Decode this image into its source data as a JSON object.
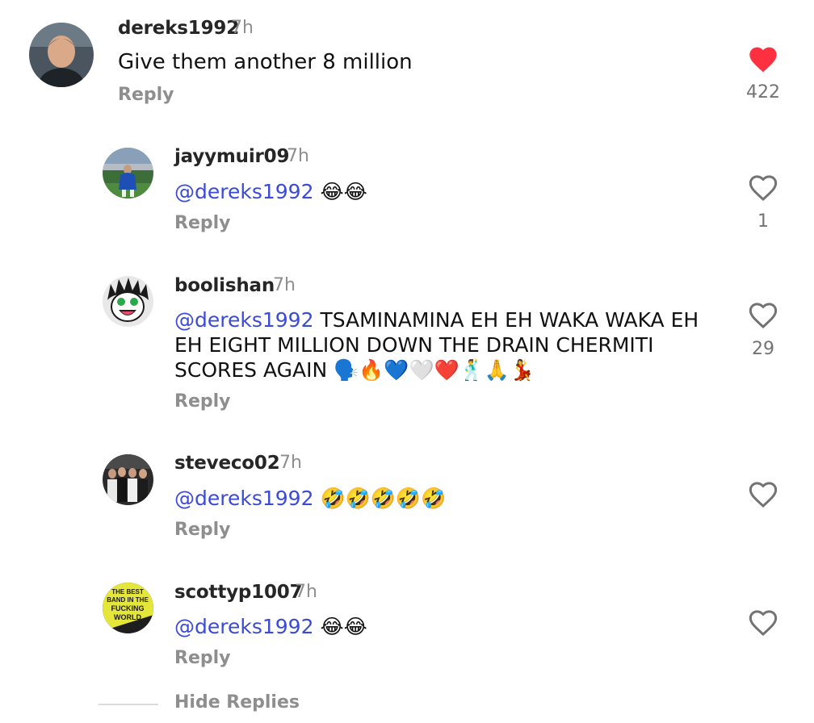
{
  "comments": [
    {
      "username": "dereks1992",
      "time": "7h",
      "text": "Give them another 8 million",
      "reply_label": "Reply",
      "likes": "422",
      "liked": true
    },
    {
      "username": "jayymuir09",
      "time": "7h",
      "mention": "@dereks1992",
      "text": " 😂😂",
      "reply_label": "Reply",
      "likes": "1",
      "liked": false
    },
    {
      "username": "boolishan",
      "time": "7h",
      "mention": "@dereks1992",
      "text": " TSAMINAMINA EH EH WAKA WAKA EH EH EIGHT MILLION DOWN THE DRAIN CHERMITI SCORES AGAIN 🗣️🔥💙🤍❤️🕺🙏💃",
      "reply_label": "Reply",
      "likes": "29",
      "liked": false
    },
    {
      "username": "steveco02",
      "time": "7h",
      "mention": "@dereks1992",
      "text": " 🤣🤣🤣🤣🤣",
      "reply_label": "Reply",
      "likes": "",
      "liked": false
    },
    {
      "username": "scottyp1007",
      "time": "7h",
      "mention": "@dereks1992",
      "text": " 😂😂",
      "reply_label": "Reply",
      "likes": "",
      "liked": false
    }
  ],
  "hide_replies_label": "Hide Replies",
  "colors": {
    "like_red": "#ff3040",
    "mention_blue": "#3b4bd8",
    "muted": "#8e8e8e"
  },
  "avatar_badge_text": [
    "THE BEST",
    "BAND IN THE",
    "FUCKING",
    "WORLD"
  ]
}
